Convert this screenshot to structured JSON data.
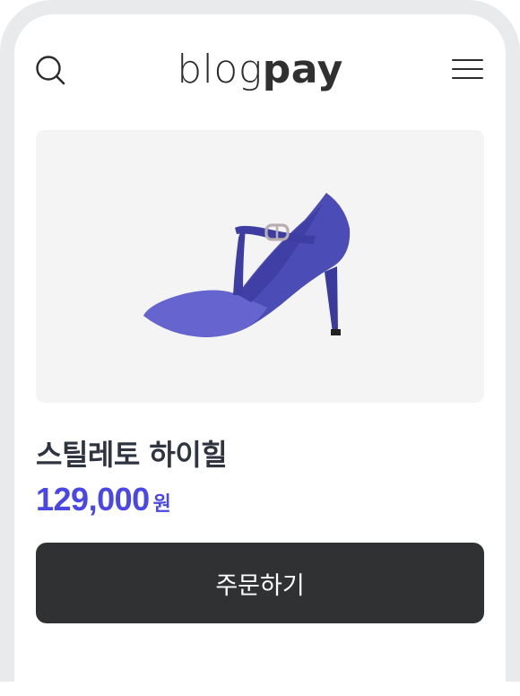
{
  "header": {
    "logo_light": "blog",
    "logo_bold": "pay",
    "search_icon": "search-icon",
    "menu_icon": "hamburger-menu-icon"
  },
  "product": {
    "image_icon": "stiletto-heel-image",
    "name": "스틸레토 하이힐",
    "price": "129,000",
    "currency": "원"
  },
  "actions": {
    "order_label": "주문하기"
  },
  "colors": {
    "price_accent": "#4a47e6",
    "button_bg": "#303133",
    "image_bg": "#f4f4f5",
    "frame": "#e9eaec",
    "shoe_main": "#4b4cb5",
    "shoe_light": "#6665cf",
    "shoe_dark": "#3a3a9c"
  }
}
